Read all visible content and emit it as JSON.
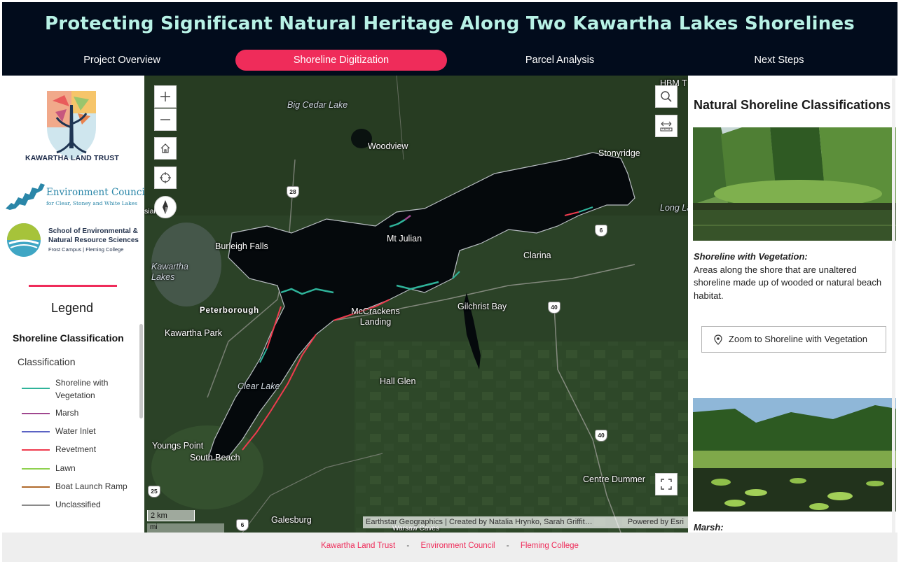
{
  "header": {
    "title": "Protecting Significant Natural Heritage Along Two Kawartha Lakes Shorelines",
    "tabs": [
      {
        "label": "Project Overview",
        "active": false
      },
      {
        "label": "Shoreline Digitization",
        "active": true
      },
      {
        "label": "Parcel Analysis",
        "active": false
      },
      {
        "label": "Next Steps",
        "active": false
      }
    ]
  },
  "logos": {
    "klt": "KAWARTHA LAND TRUST",
    "ec_title": "Environment Council",
    "ec_sub": "for Clear, Stoney and White Lakes",
    "fleming_l1": "School of Environmental &",
    "fleming_l2": "Natural Resource Sciences",
    "fleming_l3": "Frost Campus | Fleming College"
  },
  "legend": {
    "title": "Legend",
    "layer": "Shoreline Classification",
    "field": "Classification",
    "items": [
      {
        "label": "Shoreline with Vegetation",
        "color": "#2fb39a"
      },
      {
        "label": "Marsh",
        "color": "#a0478f"
      },
      {
        "label": "Water Inlet",
        "color": "#5b63c4"
      },
      {
        "label": "Revetment",
        "color": "#ef3b4e"
      },
      {
        "label": "Lawn",
        "color": "#8fd14f"
      },
      {
        "label": "Boat Launch Ramp",
        "color": "#b06a2c"
      },
      {
        "label": "Unclassified",
        "color": "#8a8a8a"
      }
    ]
  },
  "map": {
    "labels": {
      "big_cedar": "Big Cedar Lake",
      "woodview": "Woodview",
      "stonyridge": "Stonyridge",
      "hbm": "HBM T",
      "long_lake": "Long La",
      "burleigh": "Burleigh Falls",
      "mt_julian": "Mt Julian",
      "clarina": "Clarina",
      "kawartha_lakes": "Kawartha Lakes",
      "peterborough": "Peterborough",
      "mccrackens": "McCrackens Landing",
      "gilchrist": "Gilchrist Bay",
      "kawartha_park": "Kawartha Park",
      "clear_lake": "Clear Lake",
      "hall_glen": "Hall Glen",
      "youngs_point": "Youngs Point",
      "south_beach": "South Beach",
      "centre_dummer": "Centre Dummer",
      "galesburg": "Galesburg",
      "warsaw_caves": "Warsaw Caves",
      "sial_park": "sial Park"
    },
    "shields": {
      "r28": "28",
      "r6a": "6",
      "r40a": "40",
      "r40b": "40",
      "r25": "25",
      "r6b": "6"
    },
    "scale": "2 km",
    "scale2": "mi",
    "attribution": "Earthstar Geographics | Created by Natalia Hrynko, Sarah Griffit…",
    "powered": "Powered by Esri"
  },
  "panel": {
    "title": "Natural Shoreline Classifications",
    "caption_title": "Shoreline with Vegetation:",
    "caption_body": "Areas along the shore that are unaltered shoreline made up of wooded or natural beach habitat.",
    "zoom_label": "Zoom to Shoreline with Vegetation",
    "marsh_title": "Marsh:"
  },
  "footer": {
    "links": [
      "Kawartha Land Trust",
      "Environment Council",
      "Fleming College"
    ],
    "separator": "-"
  }
}
